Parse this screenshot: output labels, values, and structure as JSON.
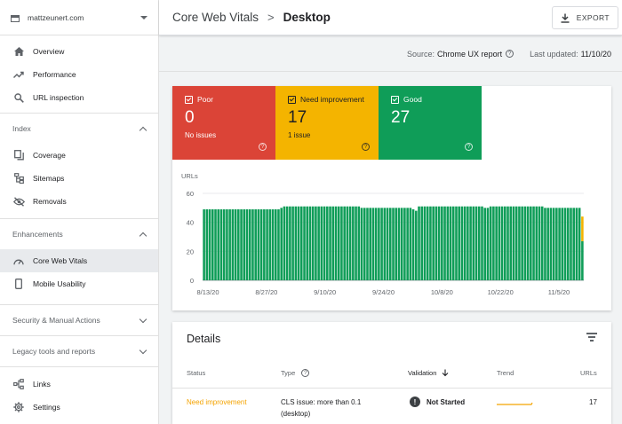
{
  "sidebar": {
    "property": "mattzeunert.com",
    "top_items": [
      {
        "label": "Overview",
        "icon": "home-icon"
      },
      {
        "label": "Performance",
        "icon": "trending-up-icon"
      },
      {
        "label": "URL inspection",
        "icon": "search-icon"
      }
    ],
    "index_section": {
      "label": "Index",
      "items": [
        {
          "label": "Coverage",
          "icon": "file-copy-icon"
        },
        {
          "label": "Sitemaps",
          "icon": "sitemap-icon"
        },
        {
          "label": "Removals",
          "icon": "visibility-off-icon"
        }
      ]
    },
    "enh_section": {
      "label": "Enhancements",
      "items": [
        {
          "label": "Core Web Vitals",
          "icon": "speed-gauge-icon",
          "active": true
        },
        {
          "label": "Mobile Usability",
          "icon": "smartphone-icon"
        }
      ]
    },
    "security_label": "Security & Manual Actions",
    "legacy_label": "Legacy tools and reports",
    "bottom_items": [
      {
        "label": "Links",
        "icon": "links-icon"
      },
      {
        "label": "Settings",
        "icon": "gear-icon"
      }
    ]
  },
  "header": {
    "crumb": "Core Web Vitals",
    "separator": ">",
    "current": "Desktop",
    "export_label": "EXPORT"
  },
  "source_bar": {
    "source_label": "Source:",
    "source_value": "Chrome UX report",
    "updated_label": "Last updated:",
    "updated_value": "11/10/20"
  },
  "summary": {
    "poor": {
      "label": "Poor",
      "count": "0",
      "sub": "No issues",
      "color": "#db4437"
    },
    "ni": {
      "label": "Need improvement",
      "count": "17",
      "sub": "1 issue",
      "color": "#f4b400"
    },
    "good": {
      "label": "Good",
      "count": "27",
      "sub": "",
      "color": "#0f9d58"
    }
  },
  "chart_data": {
    "type": "bar",
    "stacked": true,
    "ylabel": "URLs",
    "ylim": [
      0,
      60
    ],
    "yticks": [
      0,
      20,
      40,
      60
    ],
    "xtick_labels": [
      "8/13/20",
      "8/27/20",
      "9/10/20",
      "9/24/20",
      "10/8/20",
      "10/22/20",
      "11/5/20"
    ],
    "series": [
      {
        "color": "#0f9d58",
        "values": [
          49,
          49,
          49,
          49,
          49,
          49,
          49,
          49,
          49,
          49,
          49,
          49,
          49,
          49,
          49,
          49,
          49,
          49,
          49,
          49,
          49,
          49,
          49,
          49,
          49,
          49,
          49,
          50,
          51,
          51,
          51,
          51,
          51,
          51,
          51,
          51,
          51,
          51,
          51,
          51,
          51,
          51,
          51,
          51,
          51,
          51,
          51,
          51,
          51,
          51,
          51,
          51,
          51,
          51,
          51,
          50,
          50,
          50,
          50,
          50,
          50,
          50,
          50,
          50,
          50,
          50,
          50,
          50,
          50,
          50,
          50,
          50,
          50,
          49,
          48,
          51,
          51,
          51,
          51,
          51,
          51,
          51,
          51,
          51,
          51,
          51,
          51,
          51,
          51,
          51,
          51,
          51,
          51,
          51,
          51,
          51,
          51,
          51,
          50,
          50,
          51,
          51,
          51,
          51,
          51,
          51,
          51,
          51,
          51,
          51,
          51,
          51,
          51,
          51,
          51,
          51,
          51,
          51,
          51,
          50,
          50,
          50,
          50,
          50,
          50,
          50,
          50,
          50,
          50,
          50,
          50,
          50,
          27
        ]
      },
      {
        "color": "#f4b400",
        "values": [
          0,
          0,
          0,
          0,
          0,
          0,
          0,
          0,
          0,
          0,
          0,
          0,
          0,
          0,
          0,
          0,
          0,
          0,
          0,
          0,
          0,
          0,
          0,
          0,
          0,
          0,
          0,
          0,
          0,
          0,
          0,
          0,
          0,
          0,
          0,
          0,
          0,
          0,
          0,
          0,
          0,
          0,
          0,
          0,
          0,
          0,
          0,
          0,
          0,
          0,
          0,
          0,
          0,
          0,
          0,
          0,
          0,
          0,
          0,
          0,
          0,
          0,
          0,
          0,
          0,
          0,
          0,
          0,
          0,
          0,
          0,
          0,
          0,
          0,
          0,
          0,
          0,
          0,
          0,
          0,
          0,
          0,
          0,
          0,
          0,
          0,
          0,
          0,
          0,
          0,
          0,
          0,
          0,
          0,
          0,
          0,
          0,
          0,
          0,
          0,
          0,
          0,
          0,
          0,
          0,
          0,
          0,
          0,
          0,
          0,
          0,
          0,
          0,
          0,
          0,
          0,
          0,
          0,
          0,
          0,
          0,
          0,
          0,
          0,
          0,
          0,
          0,
          0,
          0,
          0,
          0,
          0,
          17
        ]
      }
    ],
    "grid": true
  },
  "details": {
    "title": "Details",
    "columns": {
      "status": "Status",
      "type": "Type",
      "validation": "Validation",
      "trend": "Trend",
      "urls": "URLs"
    },
    "rows": [
      {
        "status": "Need improvement",
        "type_line1": "CLS issue: more than 0.1",
        "type_line2": "(desktop)",
        "validation": "Not Started",
        "trend_color": "#f4b400",
        "urls": "17"
      }
    ]
  }
}
